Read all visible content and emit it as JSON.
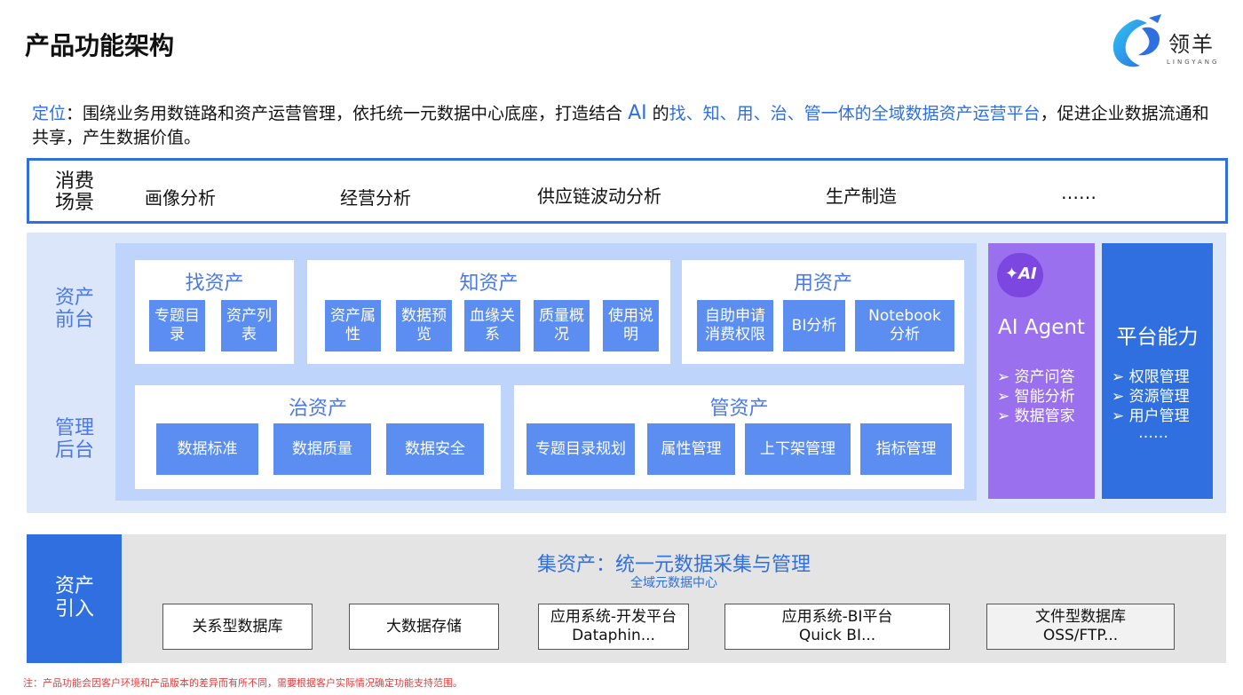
{
  "title": "产品功能架构",
  "logo": {
    "name": "领羊",
    "sub": "LINGYANG"
  },
  "positioning": {
    "label": "定位",
    "text1": "：围绕业务用数链路和资产运营管理，依托统一元数据中心底座，打造结合 ",
    "ai": "AI",
    "text2": " 的",
    "highlight": "找、知、用、治、管一体的全域数据资产运营平台",
    "text3": "，促进企业数据流通和共享，产生数据价值。"
  },
  "consume": {
    "label": "消费场景",
    "scenes": [
      "画像分析",
      "经营分析",
      "供应链波动分析",
      "生产制造",
      "……"
    ]
  },
  "mid_labels": {
    "front": "资产前台",
    "manage": "管理后台"
  },
  "find": {
    "title": "找资产",
    "items": [
      "专题目录",
      "资产列表"
    ]
  },
  "know": {
    "title": "知资产",
    "items": [
      "资产属性",
      "数据预览",
      "血缘关系",
      "质量概况",
      "使用说明"
    ]
  },
  "use": {
    "title": "用资产",
    "items": [
      "自助申请消费权限",
      "BI分析",
      "Notebook分析"
    ]
  },
  "govern": {
    "title": "治资产",
    "items": [
      "数据标准",
      "数据质量",
      "数据安全"
    ]
  },
  "manage": {
    "title": "管资产",
    "items": [
      "专题目录规划",
      "属性管理",
      "上下架管理",
      "指标管理"
    ]
  },
  "ai_agent": {
    "icon": "ai-sparkle-icon",
    "icon_text": "AI",
    "title": "AI Agent",
    "items": [
      "资产问答",
      "智能分析",
      "数据管家"
    ]
  },
  "platform": {
    "title": "平台能力",
    "items": [
      "权限管理",
      "资源管理",
      "用户管理"
    ],
    "more": "……"
  },
  "intake": {
    "label": "资产引入",
    "title": "集资产：统一元数据采集与管理",
    "sub": "全域元数据中心",
    "sources": [
      {
        "line1": "关系型数据库",
        "line2": ""
      },
      {
        "line1": "大数据存储",
        "line2": ""
      },
      {
        "line1": "应用系统-开发平台",
        "line2": "Dataphin..."
      },
      {
        "line1": "应用系统-BI平台",
        "line2": "Quick BI..."
      },
      {
        "line1": "文件型数据库",
        "line2": "OSS/FTP..."
      }
    ]
  },
  "note": "注：产品功能会因客户环境和产品版本的差异而有所不同，需要根据客户实际情况确定功能支持范围。",
  "colors": {
    "primary": "#2f6fe0",
    "button": "#5b8ef0",
    "ai": "#9b70ee",
    "note": "#e53b3b"
  }
}
